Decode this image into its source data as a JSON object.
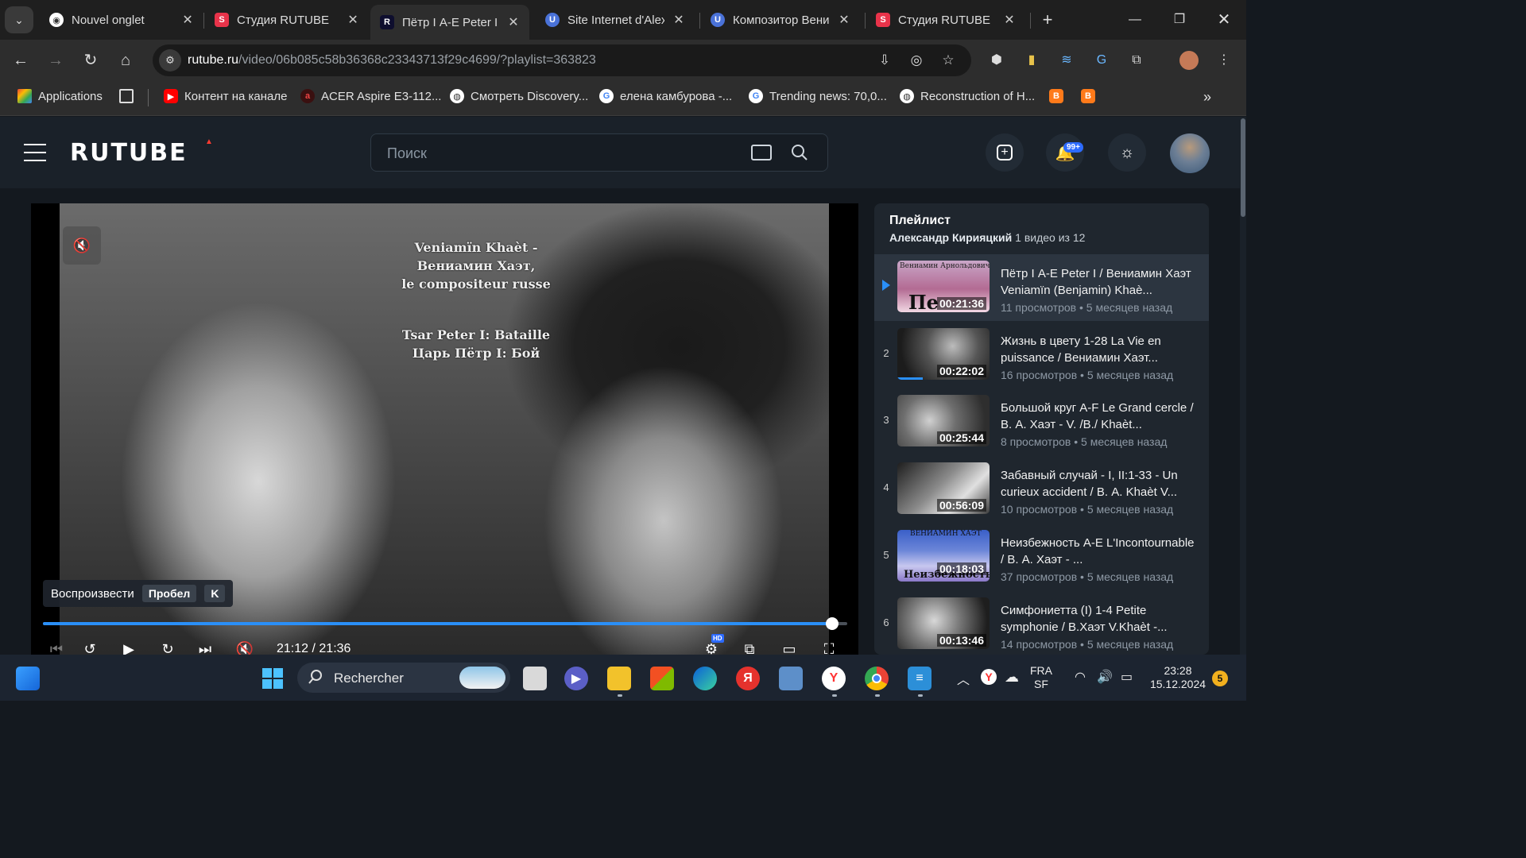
{
  "browser": {
    "tabs": [
      {
        "title": "Nouvel onglet",
        "icon": "chrome-icon"
      },
      {
        "title": "Студия RUTUBE",
        "icon": "rutube-studio-icon"
      },
      {
        "title": "Пётр I А-Е Peter I /",
        "icon": "rutube-icon",
        "active": true
      },
      {
        "title": "Site Internet d'Alex",
        "icon": "ucoz-icon"
      },
      {
        "title": "Композитор Вени",
        "icon": "ucoz-icon"
      },
      {
        "title": "Студия RUTUBE",
        "icon": "rutube-studio-icon"
      }
    ],
    "url_host": "rutube.ru",
    "url_path": "/video/06b085c58b36368c23343713f29c4699/?playlist=363823",
    "bookmarks": [
      {
        "label": "Applications",
        "icon": "apps-grid-icon"
      },
      {
        "label": "Контент на канале",
        "icon": "youtube-icon"
      },
      {
        "label": "ACER Aspire E3-112...",
        "icon": "acer-icon"
      },
      {
        "label": "Смотреть Discovery...",
        "icon": "globe-icon"
      },
      {
        "label": "елена камбурова -...",
        "icon": "google-icon"
      },
      {
        "label": "Trending news: 70,0...",
        "icon": "google-icon"
      },
      {
        "label": "Reconstruction of H...",
        "icon": "globe-icon"
      }
    ]
  },
  "rutube": {
    "logo": "RUTUBE",
    "search_placeholder": "Поиск",
    "notifications_badge": "99+"
  },
  "player": {
    "overlay_lines": [
      "Veniamïn Khaèt -",
      "Вениамин Хаэт,",
      "le compositeur russe"
    ],
    "overlay_lines2": [
      "Tsar Peter I: Bataille",
      "Царь Пётр I: Бой"
    ],
    "tooltip_label": "Воспроизвести",
    "tooltip_key1": "Пробел",
    "tooltip_key2": "K",
    "current_time": "21:12",
    "duration": "21:36",
    "progress_fraction": 0.981,
    "quality_badge": "HD"
  },
  "playlist": {
    "title": "Плейлист",
    "author": "Александр Кирияцкий",
    "position": "1 видео из 12",
    "items": [
      {
        "index": "",
        "title": "Пётр I А-Е Peter I / Вениамин Хаэт Veniamïn (Benjamin) Khaè...",
        "duration": "00:21:36",
        "views": "11 просмотров",
        "age": "5 месяцев назад",
        "active": true,
        "watched": 0.0
      },
      {
        "index": "2",
        "title": "Жизнь в цвету 1-28 La Vie en puissance / Вениамин Хаэт...",
        "duration": "00:22:02",
        "views": "16 просмотров",
        "age": "5 месяцев назад",
        "watched": 0.28
      },
      {
        "index": "3",
        "title": "Большой круг А-F Le Grand cercle / В. А. Хаэт - V. /B./ Khaèt...",
        "duration": "00:25:44",
        "views": "8 просмотров",
        "age": "5 месяцев назад",
        "watched": 0.0
      },
      {
        "index": "4",
        "title": "Забавный случай - I, II:1-33 - Un curieux accident / В. А. Khaèt V...",
        "duration": "00:56:09",
        "views": "10 просмотров",
        "age": "5 месяцев назад",
        "watched": 0.0
      },
      {
        "index": "5",
        "title": "Неизбежность А-Е L'Incontournable / В. А. Хаэт - ...",
        "duration": "00:18:03",
        "views": "37 просмотров",
        "age": "5 месяцев назад",
        "watched": 0.0
      },
      {
        "index": "6",
        "title": "Симфониетта (I) 1-4 Petite symphonie / В.Хаэт V.Khaèt -...",
        "duration": "00:13:46",
        "views": "14 просмотров",
        "age": "5 месяцев назад",
        "watched": 0.0
      }
    ],
    "thumb_caption_1": "Вениамин Арнольдович Хаэт",
    "thumb_caption_1b": "Пе",
    "thumb_caption_5": "ВЕНИАМИН ХАЭТ",
    "thumb_caption_5b": "Неизбежность"
  },
  "taskbar": {
    "search_label": "Rechercher",
    "lang": "FRA",
    "lang_sub": "SF",
    "time": "23:28",
    "date": "15.12.2024",
    "notif_count": "5"
  }
}
